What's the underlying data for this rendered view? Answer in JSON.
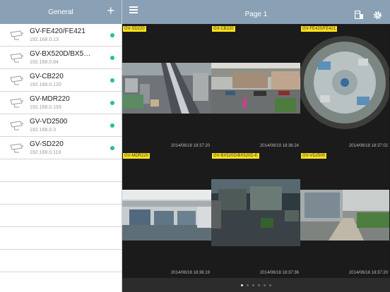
{
  "sidebar": {
    "title": "General",
    "add_icon": "plus-icon",
    "devices": [
      {
        "name": "GV-FE420/FE421",
        "ip": "192.168.0.13",
        "status": "online"
      },
      {
        "name": "GV-BX520D/BX5…",
        "ip": "192.168.0.84",
        "status": "online"
      },
      {
        "name": "GV-CB220",
        "ip": "192.168.0.120",
        "status": "online"
      },
      {
        "name": "GV-MDR220",
        "ip": "192.168.0.193",
        "status": "online"
      },
      {
        "name": "GV-VD2500",
        "ip": "192.168.0.3",
        "status": "online"
      },
      {
        "name": "GV-SD220",
        "ip": "192.168.0.119",
        "status": "online"
      }
    ],
    "status_color": "#25c28c"
  },
  "header": {
    "page_title": "Page 1",
    "menu_icon": "hamburger-menu-icon",
    "layout_icon": "layout-icon",
    "settings_icon": "gear-icon",
    "bar_color": "#8aa0b5"
  },
  "tiles": [
    {
      "label": "GV-SD220",
      "timestamp": "2014/06/18 18:37:20",
      "scene": "city-aerial"
    },
    {
      "label": "GV-CB220",
      "timestamp": "2014/06/19 18:36:24",
      "scene": "street"
    },
    {
      "label": "GV-FE420/FE421",
      "timestamp": "2014/06/18 18:37:02",
      "scene": "fisheye-office"
    },
    {
      "label": "GV-MDR220",
      "timestamp": "2014/06/18 18:36:19",
      "scene": "office"
    },
    {
      "label": "GV-BX520D/BX520D-E",
      "timestamp": "2014/06/18 18:37:36",
      "scene": "night-street"
    },
    {
      "label": "GV-VD2500",
      "timestamp": "2014/06/18 18:37:20",
      "scene": "building-street"
    }
  ],
  "pager": {
    "count": 6,
    "active": 0
  },
  "label_color": "#ffe21d"
}
